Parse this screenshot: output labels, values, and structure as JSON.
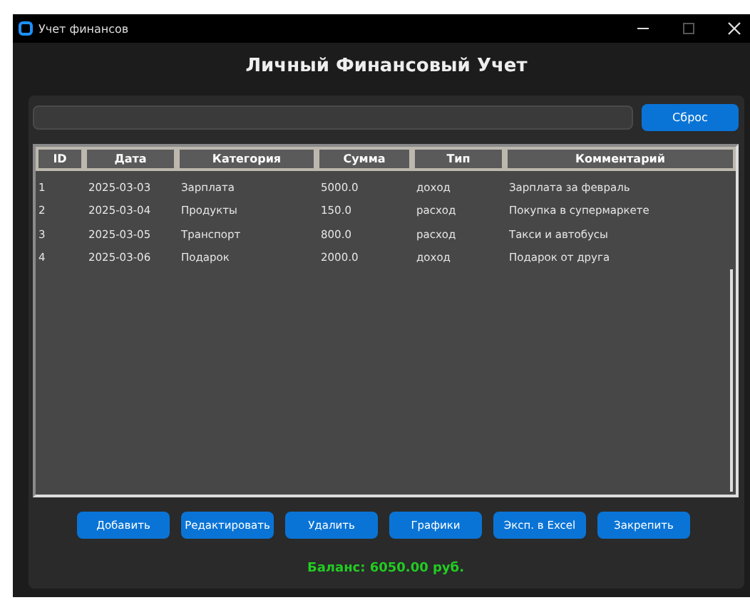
{
  "window": {
    "title": "Учет финансов"
  },
  "heading": "Личный Финансовый Учет",
  "reset_button": "Сброс",
  "table": {
    "columns": [
      "ID",
      "Дата",
      "Категория",
      "Сумма",
      "Тип",
      "Комментарий"
    ],
    "rows": [
      [
        "1",
        "2025-03-03",
        "Зарплата",
        "5000.0",
        "доход",
        "Зарплата за февраль"
      ],
      [
        "2",
        "2025-03-04",
        "Продукты",
        "150.0",
        "расход",
        "Покупка в супермаркете"
      ],
      [
        "3",
        "2025-03-05",
        "Транспорт",
        "800.0",
        "расход",
        "Такси и автобусы"
      ],
      [
        "4",
        "2025-03-06",
        "Подарок",
        "2000.0",
        "доход",
        "Подарок от друга"
      ]
    ]
  },
  "buttons": [
    "Добавить",
    "Редактировать",
    "Удалить",
    "Графики",
    "Эксп. в Excel",
    "Закрепить"
  ],
  "balance": "Баланс: 6050.00 руб."
}
